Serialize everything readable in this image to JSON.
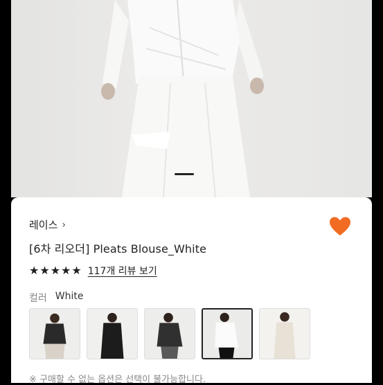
{
  "product": {
    "brand": "레이스",
    "brand_chevron": "›",
    "title": "[6차 리오더] Pleats Blouse_White",
    "stars": [
      "★",
      "★",
      "★",
      "★",
      "★"
    ],
    "rating_stars": 5,
    "review_link": "117개 리뷰 보기",
    "color_label": "컬러",
    "color_value": "White",
    "notice": "※ 구매할 수 없는 옵션은 선택이 불가능합니다."
  },
  "colors": {
    "heart": "#f26b22",
    "selected_border": "#222222"
  },
  "swatches": [
    {
      "variant": "black-cropped",
      "selected": false
    },
    {
      "variant": "black-long",
      "selected": false
    },
    {
      "variant": "black-wrap",
      "selected": false
    },
    {
      "variant": "white-skirt",
      "selected": true
    },
    {
      "variant": "ivory-long",
      "selected": false
    }
  ]
}
